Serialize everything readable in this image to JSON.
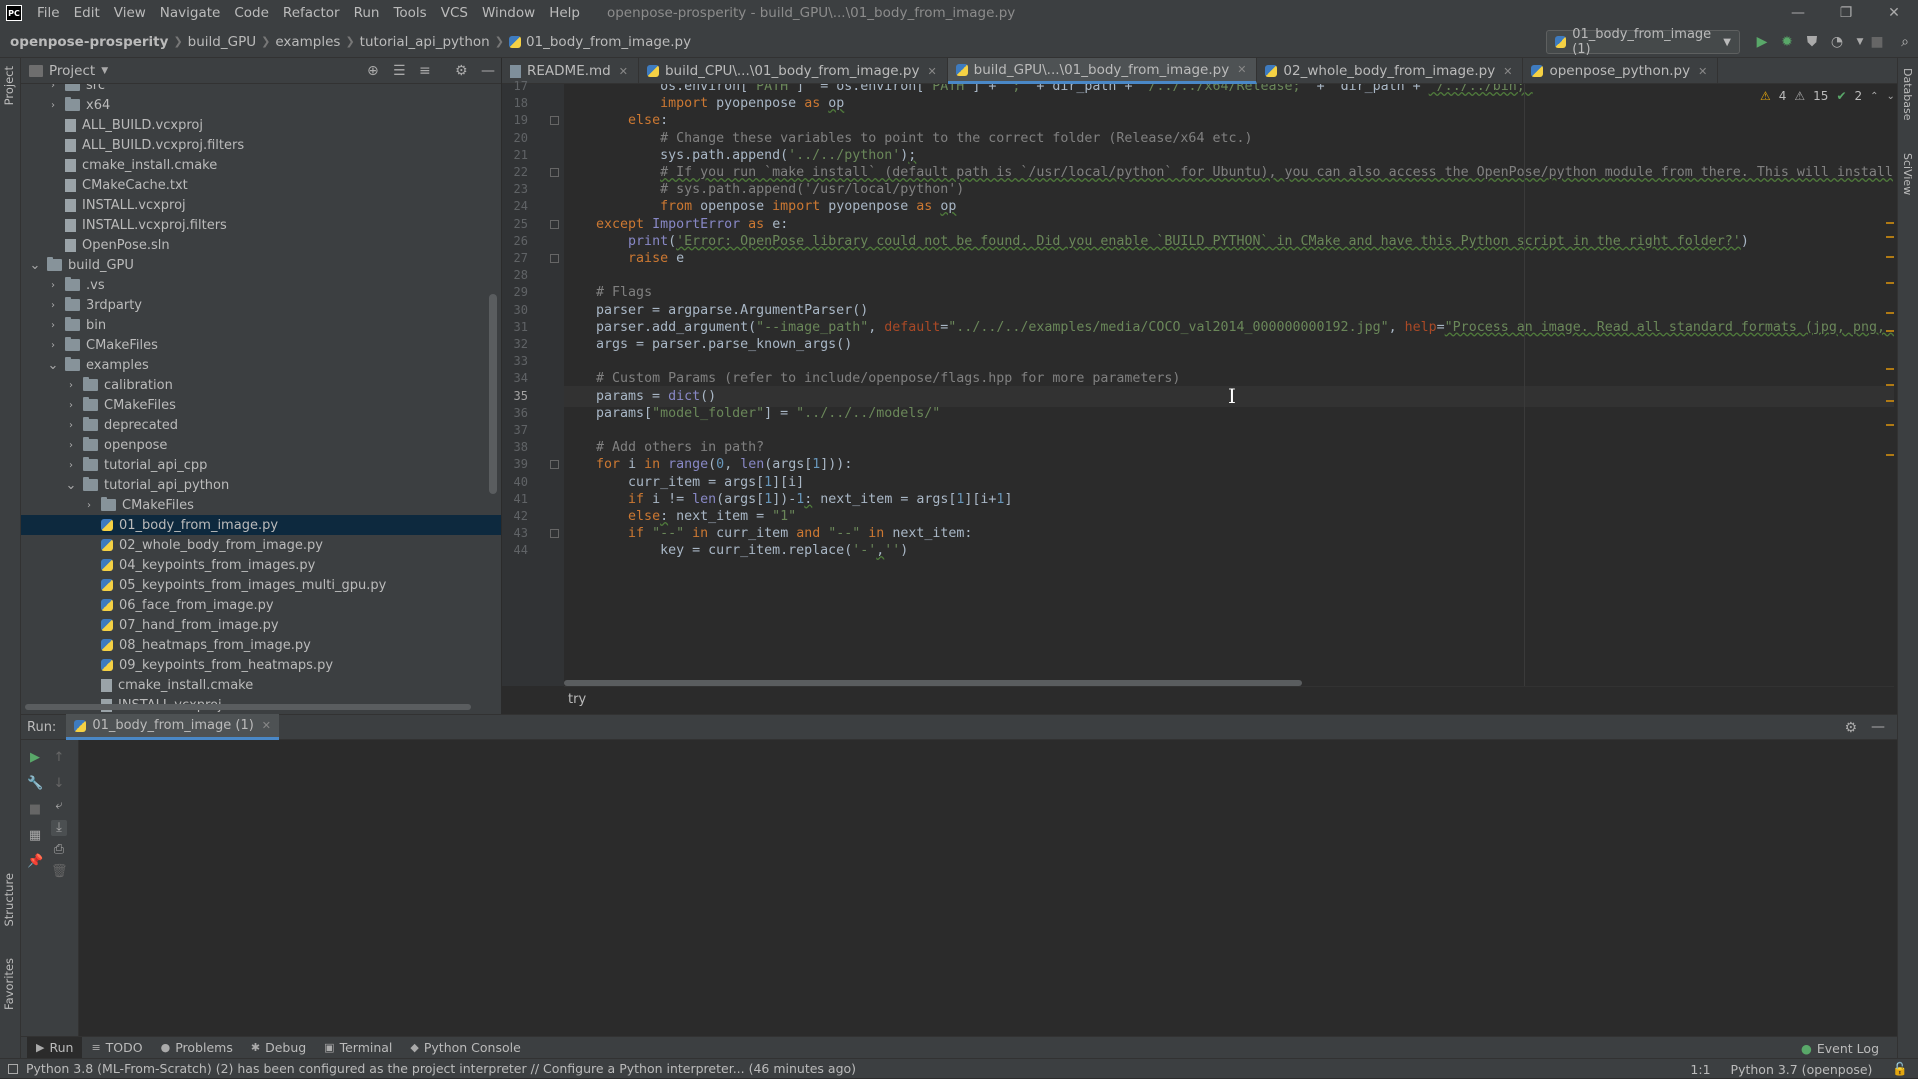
{
  "menubar": {
    "logo": "PC",
    "items": [
      "File",
      "Edit",
      "View",
      "Navigate",
      "Code",
      "Refactor",
      "Run",
      "Tools",
      "VCS",
      "Window",
      "Help"
    ],
    "window_title": "openpose-prosperity - build_GPU\\...\\01_body_from_image.py"
  },
  "window_controls": {
    "minimize": "—",
    "restore": "❐",
    "close": "✕"
  },
  "breadcrumb": [
    "openpose-prosperity",
    "build_GPU",
    "examples",
    "tutorial_api_python",
    "01_body_from_image.py"
  ],
  "run_config": {
    "label": "01_body_from_image (1)"
  },
  "left_strip": {
    "project": "Project",
    "structure": "Structure",
    "favorites": "Favorites"
  },
  "right_strip": {
    "database": "Database",
    "sciview": "SciView"
  },
  "project_panel": {
    "title": "Project"
  },
  "tree": [
    {
      "label": "src",
      "type": "folder",
      "depth": 2,
      "expanded": false
    },
    {
      "label": "x64",
      "type": "folder",
      "depth": 2,
      "expanded": false
    },
    {
      "label": "ALL_BUILD.vcxproj",
      "type": "file",
      "depth": 2
    },
    {
      "label": "ALL_BUILD.vcxproj.filters",
      "type": "file",
      "depth": 2
    },
    {
      "label": "cmake_install.cmake",
      "type": "file",
      "depth": 2
    },
    {
      "label": "CMakeCache.txt",
      "type": "file",
      "depth": 2
    },
    {
      "label": "INSTALL.vcxproj",
      "type": "file",
      "depth": 2
    },
    {
      "label": "INSTALL.vcxproj.filters",
      "type": "file",
      "depth": 2
    },
    {
      "label": "OpenPose.sln",
      "type": "file",
      "depth": 2
    },
    {
      "label": "build_GPU",
      "type": "folder",
      "depth": 1,
      "expanded": true
    },
    {
      "label": ".vs",
      "type": "folder",
      "depth": 2,
      "expanded": false
    },
    {
      "label": "3rdparty",
      "type": "folder",
      "depth": 2,
      "expanded": false
    },
    {
      "label": "bin",
      "type": "folder",
      "depth": 2,
      "expanded": false
    },
    {
      "label": "CMakeFiles",
      "type": "folder",
      "depth": 2,
      "expanded": false
    },
    {
      "label": "examples",
      "type": "folder",
      "depth": 2,
      "expanded": true
    },
    {
      "label": "calibration",
      "type": "folder",
      "depth": 3,
      "expanded": false
    },
    {
      "label": "CMakeFiles",
      "type": "folder",
      "depth": 3,
      "expanded": false
    },
    {
      "label": "deprecated",
      "type": "folder",
      "depth": 3,
      "expanded": false
    },
    {
      "label": "openpose",
      "type": "folder",
      "depth": 3,
      "expanded": false
    },
    {
      "label": "tutorial_api_cpp",
      "type": "folder",
      "depth": 3,
      "expanded": false
    },
    {
      "label": "tutorial_api_python",
      "type": "folder",
      "depth": 3,
      "expanded": true
    },
    {
      "label": "CMakeFiles",
      "type": "folder",
      "depth": 4,
      "expanded": false
    },
    {
      "label": "01_body_from_image.py",
      "type": "py",
      "depth": 4,
      "selected": true
    },
    {
      "label": "02_whole_body_from_image.py",
      "type": "py",
      "depth": 4
    },
    {
      "label": "04_keypoints_from_images.py",
      "type": "py",
      "depth": 4
    },
    {
      "label": "05_keypoints_from_images_multi_gpu.py",
      "type": "py",
      "depth": 4
    },
    {
      "label": "06_face_from_image.py",
      "type": "py",
      "depth": 4
    },
    {
      "label": "07_hand_from_image.py",
      "type": "py",
      "depth": 4
    },
    {
      "label": "08_heatmaps_from_image.py",
      "type": "py",
      "depth": 4
    },
    {
      "label": "09_keypoints_from_heatmaps.py",
      "type": "py",
      "depth": 4
    },
    {
      "label": "cmake_install.cmake",
      "type": "file",
      "depth": 4
    },
    {
      "label": "INSTALL.vcxproj",
      "type": "file",
      "depth": 4
    }
  ],
  "tabs": [
    {
      "label": "README.md",
      "icon": "md",
      "active": false
    },
    {
      "label": "build_CPU\\...\\01_body_from_image.py",
      "icon": "py",
      "active": false
    },
    {
      "label": "build_GPU\\...\\01_body_from_image.py",
      "icon": "py",
      "active": true
    },
    {
      "label": "02_whole_body_from_image.py",
      "icon": "py",
      "active": false
    },
    {
      "label": "openpose_python.py",
      "icon": "py",
      "active": false
    }
  ],
  "inspections": {
    "warnings": "4",
    "weak": "15",
    "ok": "2"
  },
  "code_lines": [
    {
      "n": "17",
      "html": "            os.environ[<span class=\"st\">'PATH'</span>]  = os.environ[<span class=\"st\">'PATH'</span>] + <span class=\"st\">';'</span> + dir_path + <span class=\"st\">'/../../x64/Release;'</span> +  dir_path + <span class=\"st und\">'/../../bin;'</span>"
    },
    {
      "n": "18",
      "html": "            <span class=\"kw\">import</span> pyopenpose <span class=\"kw\">as</span> <span class=\"und\">op</span>"
    },
    {
      "n": "19",
      "html": "        <span class=\"kw\">else</span>:"
    },
    {
      "n": "20",
      "html": "            <span class=\"cm\"># Change these variables to point to the correct folder (Release/x64 etc.)</span>"
    },
    {
      "n": "21",
      "html": "            sys.path.append(<span class=\"st\">'../../python'</span>)<span class=\"und\">;</span>"
    },
    {
      "n": "22",
      "html": "            <span class=\"cm und\"># If you run `make install` (default path is `/usr/local/python` for Ubuntu), you can also access the OpenPose/python module from there. This will install</span>"
    },
    {
      "n": "23",
      "html": "            <span class=\"cm\"># sys.path.append('/usr/local/python')</span>"
    },
    {
      "n": "24",
      "html": "            <span class=\"kw\">from</span> openpose <span class=\"kw\">import</span> pyopenpose <span class=\"kw\">as</span> <span class=\"und\">op</span>"
    },
    {
      "n": "25",
      "html": "    <span class=\"kw\">except</span> <span class=\"bi\">ImportError</span> <span class=\"kw\">as</span> e:"
    },
    {
      "n": "26",
      "html": "        <span class=\"bi\">print</span>(<span class=\"st und\">'Error: OpenPose library could not be found. Did you enable `BUILD_PYTHON` in CMake and have this Python script in the right folder?'</span>)"
    },
    {
      "n": "27",
      "html": "        <span class=\"kw\">raise</span> e"
    },
    {
      "n": "28",
      "html": ""
    },
    {
      "n": "29",
      "html": "    <span class=\"cm\"># Flags</span>"
    },
    {
      "n": "30",
      "html": "    parser = argparse.ArgumentParser()"
    },
    {
      "n": "31",
      "html": "    parser.add_argument(<span class=\"st\">\"--image_path\"</span>, <span class=\"kw\" style=\"color:#aa4926\">default</span>=<span class=\"st\">\"../../../examples/media/COCO_val2014_000000000192.jpg\"</span>, <span style=\"color:#aa4926\">help</span>=<span class=\"st und\">\"Process an image. Read all standard formats (jpg, png, b</span>"
    },
    {
      "n": "32",
      "html": "    args = parser.parse_known_args()"
    },
    {
      "n": "33",
      "html": ""
    },
    {
      "n": "34",
      "html": "    <span class=\"cm\"># Custom Params (refer to include/openpose/flags.hpp for more parameters)</span>"
    },
    {
      "n": "35",
      "html": "    params = <span class=\"bi\">dict</span>()",
      "current": true
    },
    {
      "n": "36",
      "html": "    params[<span class=\"st\">\"model_folder\"</span>] = <span class=\"st\">\"../../../models/\"</span>"
    },
    {
      "n": "37",
      "html": ""
    },
    {
      "n": "38",
      "html": "    <span class=\"cm\"># Add others in path?</span>"
    },
    {
      "n": "39",
      "html": "    <span class=\"kw\">for</span> i <span class=\"kw\">in</span> <span class=\"bi\">range</span>(<span class=\"num\">0</span>, <span class=\"bi\">len</span>(args[<span class=\"num\">1</span>])):"
    },
    {
      "n": "40",
      "html": "        curr_item = args[<span class=\"num\">1</span>][i]"
    },
    {
      "n": "41",
      "html": "        <span class=\"kw\">if</span> i != <span class=\"bi\">len</span>(args[<span class=\"num\">1</span>])-<span class=\"num\">1</span><span class=\"und\">:</span> next_item = args[<span class=\"num\">1</span>][i+<span class=\"num\">1</span>]"
    },
    {
      "n": "42",
      "html": "        <span class=\"kw\">else</span><span class=\"und\">:</span> next_item = <span class=\"st\">\"1\"</span>"
    },
    {
      "n": "43",
      "html": "        <span class=\"kw\">if</span> <span class=\"st\">\"--\"</span> <span class=\"kw\">in</span> curr_item <span class=\"kw\">and</span> <span class=\"st\">\"--\"</span> <span class=\"kw\">in</span> next_item:"
    },
    {
      "n": "44",
      "html": "            key = curr_item.replace(<span class=\"st\">'-'</span><span class=\"und\">,</span><span class=\"st\">''</span>)"
    }
  ],
  "editor_breadcrumb": "try",
  "run_panel": {
    "label": "Run:",
    "tab": "01_body_from_image (1)"
  },
  "bottom_tools": [
    {
      "label": "Run",
      "glyph": "▶",
      "active": true
    },
    {
      "label": "TODO",
      "glyph": "≡"
    },
    {
      "label": "Problems",
      "glyph": "●"
    },
    {
      "label": "Debug",
      "glyph": "✱"
    },
    {
      "label": "Terminal",
      "glyph": "▣"
    },
    {
      "label": "Python Console",
      "glyph": "◆"
    }
  ],
  "event_log": "Event Log",
  "status": {
    "message": "Python 3.8 (ML-From-Scratch) (2) has been configured as the project interpreter // Configure a Python interpreter... (46 minutes ago)",
    "position": "1:1",
    "interpreter": "Python 3.7 (openpose)"
  },
  "colors": {
    "accent": "#4a88c7",
    "selection": "#0d293e",
    "keyword": "#cc7832",
    "string": "#6a8759",
    "comment": "#808080"
  }
}
